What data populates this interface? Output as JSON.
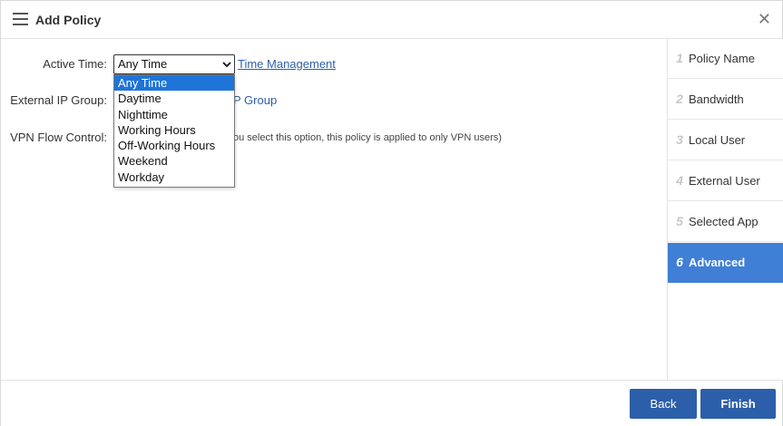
{
  "header": {
    "title": "Add Policy",
    "close_glyph": "✕"
  },
  "form": {
    "active_time_label": "Active Time:",
    "active_time_value": "Any Time",
    "time_management_link": "Time Management",
    "external_ip_group_label": "External IP Group:",
    "external_ip_group_link": "P Group",
    "vpn_flow_control_label": "VPN Flow Control:",
    "vpn_note": "ou select this option, this policy is applied to only VPN users)"
  },
  "dropdown": {
    "options": [
      "Any Time",
      "Daytime",
      "Nighttime",
      "Working Hours",
      "Off-Working Hours",
      "Weekend",
      "Workday"
    ],
    "selected_index": 0
  },
  "steps": [
    {
      "num": "1",
      "label": "Policy Name"
    },
    {
      "num": "2",
      "label": "Bandwidth"
    },
    {
      "num": "3",
      "label": "Local User"
    },
    {
      "num": "4",
      "label": "External User"
    },
    {
      "num": "5",
      "label": "Selected App"
    },
    {
      "num": "6",
      "label": "Advanced"
    }
  ],
  "active_step_index": 5,
  "footer": {
    "back_label": "Back",
    "finish_label": "Finish"
  },
  "colors": {
    "accent": "#3f7fd6",
    "button": "#2c5fa9",
    "link": "#2e5fa8",
    "dropdown_selected": "#1e74d8"
  },
  "icons": {
    "menu": "hamburger-icon",
    "close": "close-icon",
    "select_chevron": "chevron-down-icon"
  }
}
